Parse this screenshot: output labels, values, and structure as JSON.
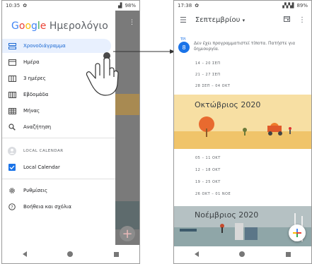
{
  "left": {
    "status": {
      "time": "10:35",
      "battery": "98%"
    },
    "app_title": {
      "g": "G",
      "o1": "o",
      "o2": "o",
      "g2": "g",
      "l": "l",
      "e": "e",
      "rest": " Ημερολόγιο"
    },
    "drawer_items": [
      {
        "label": "Χρονοδιάγραμμα",
        "icon": "schedule-icon"
      },
      {
        "label": "Ημέρα",
        "icon": "day-icon"
      },
      {
        "label": "3 ημέρες",
        "icon": "three-day-icon"
      },
      {
        "label": "Εβδομάδα",
        "icon": "week-icon"
      },
      {
        "label": "Μήνας",
        "icon": "month-icon"
      },
      {
        "label": "Αναζήτηση",
        "icon": "search-icon"
      }
    ],
    "calendar_section": "LOCAL CALENDAR",
    "calendar_item": "Local Calendar",
    "settings": "Ρυθμίσεις",
    "help": "Βοήθεια και σχόλια"
  },
  "right": {
    "status": {
      "time": "17:38",
      "battery": "89%"
    },
    "month_title": "Σεπτεμβρίου",
    "day_label": "ΤΡΙ",
    "day_number": "8",
    "no_events": "Δεν έχει προγραμματιστεί τίποτα. Πατήστε για δημιουργία.",
    "sept_weeks": [
      "14 – 20 ΣΕΠ",
      "21 – 27 ΣΕΠ",
      "28 ΣΕΠ – 04 ΟΚΤ"
    ],
    "october": "Οκτώβριος 2020",
    "oct_weeks": [
      "05 – 11 ΟΚΤ",
      "12 – 18 ΟΚΤ",
      "19 – 25 ΟΚΤ",
      "26 ΟΚΤ – 01 ΝΟΕ"
    ],
    "november": "Νοέμβριος 2020"
  },
  "colors": {
    "accent": "#1a73e8",
    "selected_bg": "#e8f0fe"
  }
}
